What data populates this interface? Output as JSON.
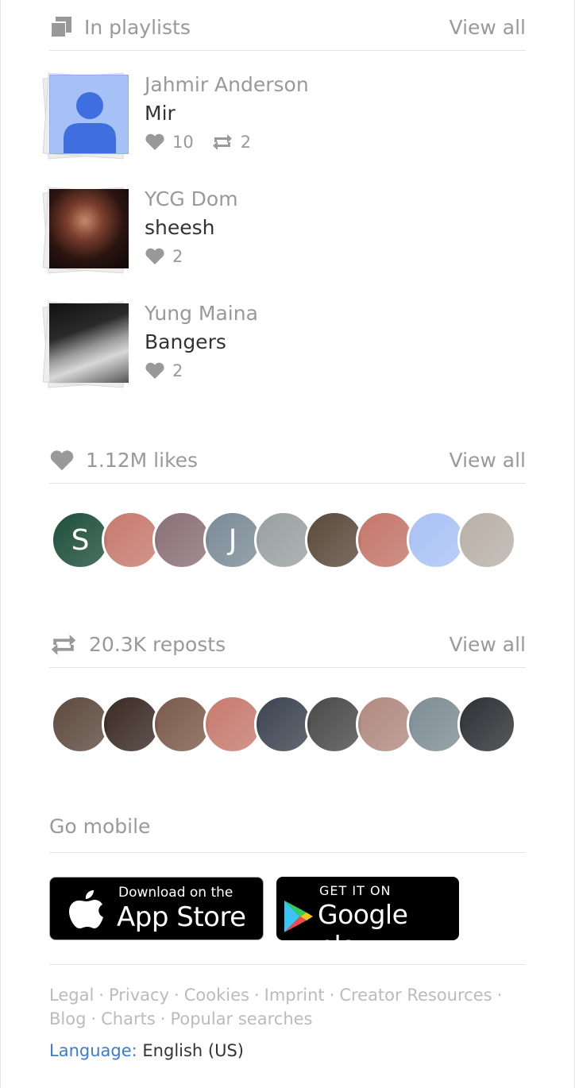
{
  "playlists": {
    "heading": "In playlists",
    "view_all": "View all",
    "items": [
      {
        "user": "Jahmir Anderson",
        "name": "Mir",
        "likes": "10",
        "reposts": "2"
      },
      {
        "user": "YCG Dom",
        "name": "sheesh",
        "likes": "2"
      },
      {
        "user": "Yung Maina",
        "name": "Bangers",
        "likes": "2"
      }
    ]
  },
  "likes": {
    "heading": "1.12M likes",
    "view_all": "View all",
    "avatars": [
      {
        "letter": "S",
        "color": "#1f4f3c"
      },
      {
        "letter": "",
        "color": "#c77a6e"
      },
      {
        "letter": "",
        "color": "#8a7077"
      },
      {
        "letter": "J",
        "color": "#7b8b96"
      },
      {
        "letter": "",
        "color": "#9aa0a0"
      },
      {
        "letter": "",
        "color": "#5a4a3a"
      },
      {
        "letter": "",
        "color": "#c4766a"
      },
      {
        "letter": "",
        "color": "#a9c2f5"
      },
      {
        "letter": "",
        "color": "#b8b0a8"
      }
    ]
  },
  "reposts": {
    "heading": "20.3K reposts",
    "view_all": "View all",
    "avatars": [
      {
        "color": "#5d4a3f"
      },
      {
        "color": "#3a2a24"
      },
      {
        "color": "#7a5a4a"
      },
      {
        "color": "#c77a6e"
      },
      {
        "color": "#3c4450"
      },
      {
        "color": "#4a4a4a"
      },
      {
        "color": "#b08a80"
      },
      {
        "color": "#7e8d94"
      },
      {
        "color": "#2e3035"
      }
    ]
  },
  "mobile": {
    "heading": "Go mobile",
    "app_store": {
      "small": "Download on the",
      "big": "App Store"
    },
    "google_play": {
      "small": "GET IT ON",
      "big": "Google play"
    }
  },
  "footer": {
    "links": [
      "Legal",
      "Privacy",
      "Cookies",
      "Imprint",
      "Creator Resources",
      "Blog",
      "Charts",
      "Popular searches"
    ],
    "language_label": "Language:",
    "language_value": "English (US)"
  }
}
